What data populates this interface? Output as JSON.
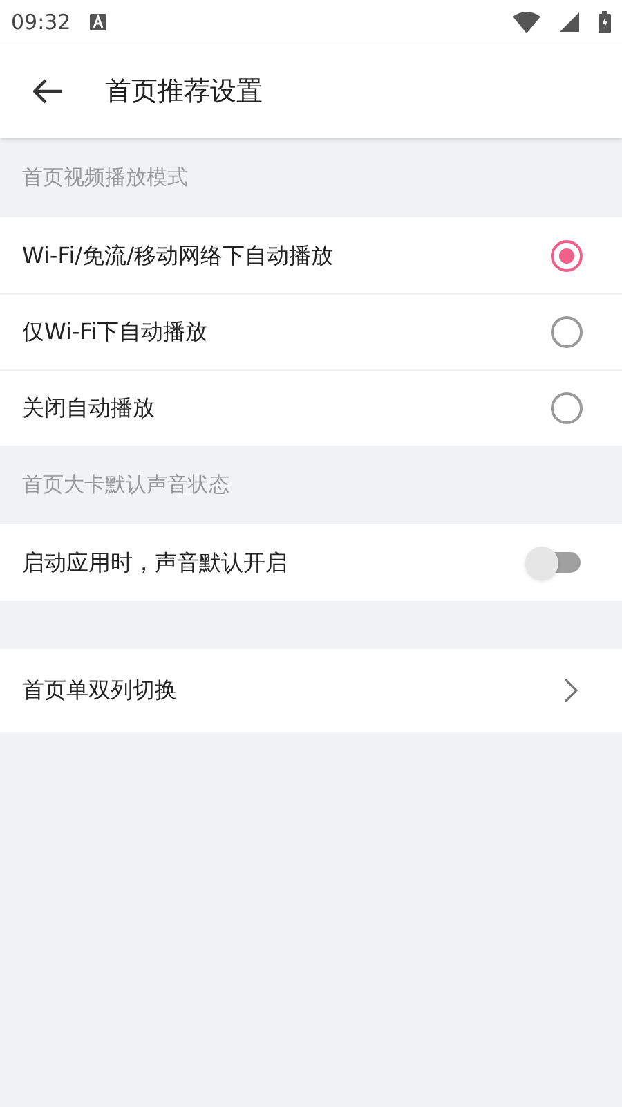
{
  "status_bar": {
    "time": "09:32"
  },
  "header": {
    "title": "首页推荐设置"
  },
  "sections": [
    {
      "title": "首页视频播放模式",
      "items": [
        {
          "kind": "radio",
          "label": "Wi-Fi/免流/移动网络下自动播放",
          "selected": true
        },
        {
          "kind": "radio",
          "label": "仅Wi-Fi下自动播放",
          "selected": false
        },
        {
          "kind": "radio",
          "label": "关闭自动播放",
          "selected": false
        }
      ]
    },
    {
      "title": "首页大卡默认声音状态",
      "items": [
        {
          "kind": "toggle",
          "label": "启动应用时，声音默认开启",
          "on": false
        }
      ]
    },
    {
      "items": [
        {
          "kind": "link",
          "label": "首页单双列切换"
        }
      ]
    }
  ]
}
